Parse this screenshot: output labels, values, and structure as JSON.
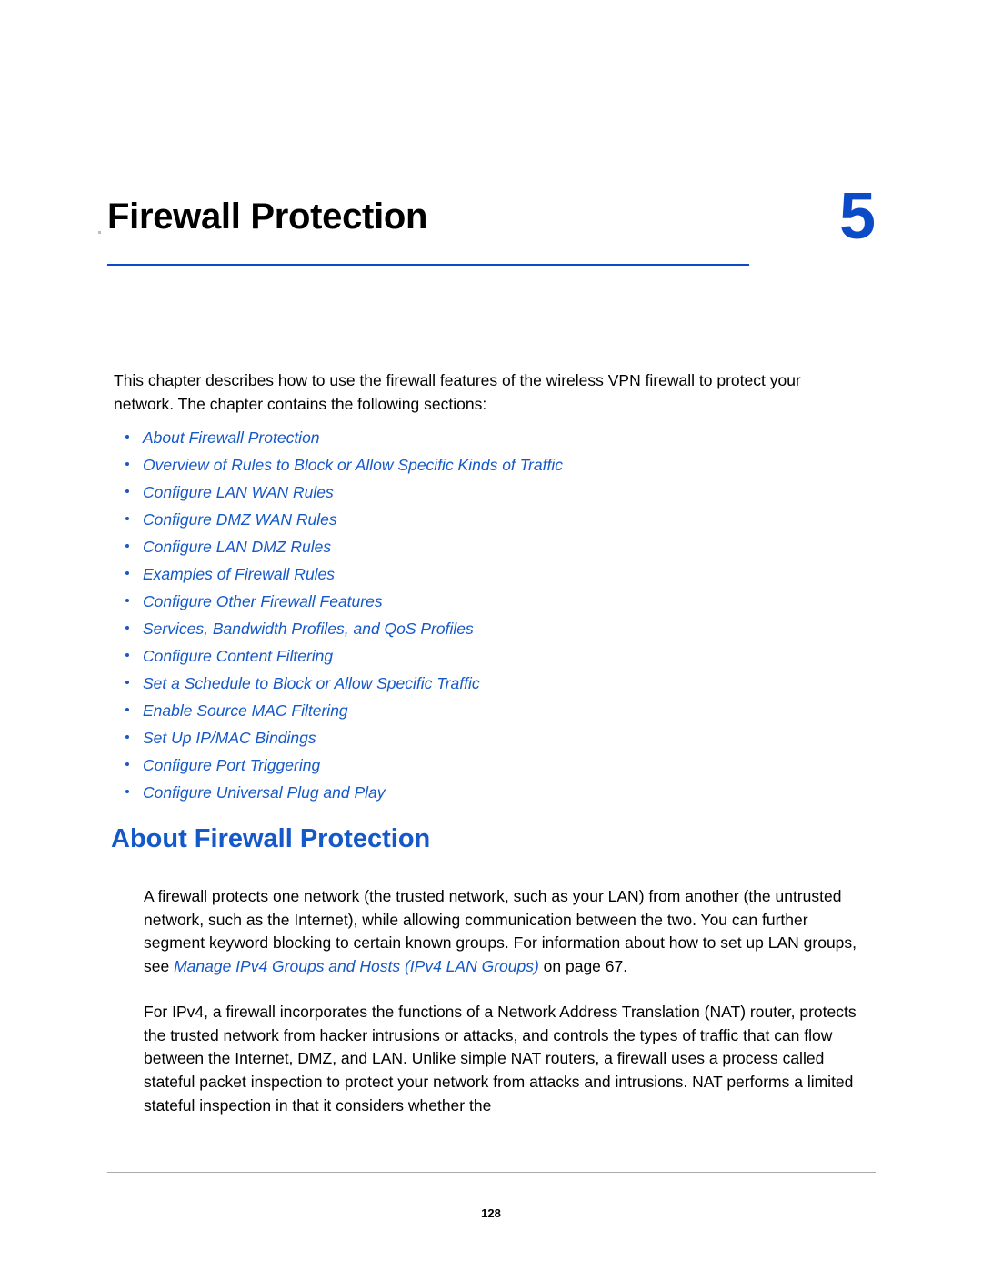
{
  "chapter": {
    "title": "Firewall Protection",
    "number": "5"
  },
  "intro": "This chapter describes how to use the firewall features of the wireless VPN firewall to protect your network. The chapter contains the following sections:",
  "toc": [
    {
      "label": "About Firewall Protection"
    },
    {
      "label": "Overview of Rules to Block or Allow Specific Kinds of Traffic"
    },
    {
      "label": "Configure LAN WAN Rules"
    },
    {
      "label": "Configure DMZ WAN Rules"
    },
    {
      "label": "Configure LAN DMZ Rules"
    },
    {
      "label": "Examples of Firewall Rules"
    },
    {
      "label": "Configure Other Firewall Features"
    },
    {
      "label": "Services, Bandwidth Profiles, and QoS Profiles"
    },
    {
      "label": "Configure Content Filtering"
    },
    {
      "label": "Set a Schedule to Block or Allow Specific Traffic"
    },
    {
      "label": "Enable Source MAC Filtering"
    },
    {
      "label": "Set Up IP/MAC Bindings"
    },
    {
      "label": "Configure Port Triggering"
    },
    {
      "label": "Configure Universal Plug and Play"
    }
  ],
  "section": {
    "heading": "About Firewall Protection",
    "paragraph1_part1": "A firewall protects one network (the trusted network, such as your LAN) from another (the untrusted network, such as the Internet), while allowing communication between the two. You can further segment keyword blocking to certain known groups. For information about how to set up LAN groups, see ",
    "paragraph1_link": "Manage IPv4 Groups and Hosts (IPv4 LAN Groups)",
    "paragraph1_part2": " on page 67.",
    "paragraph2": "For IPv4, a firewall incorporates the functions of a Network Address Translation (NAT) router, protects the trusted network from hacker intrusions or attacks, and controls the types of traffic that can flow between the Internet, DMZ, and LAN. Unlike simple NAT routers, a firewall uses a process called stateful packet inspection to protect your network from attacks and intrusions. NAT performs a limited stateful inspection in that it considers whether the"
  },
  "footer": {
    "page_number": "128"
  },
  "colors": {
    "accent_blue": "#1558c8",
    "rule_blue": "#0b4bc8",
    "text_black": "#000000"
  }
}
